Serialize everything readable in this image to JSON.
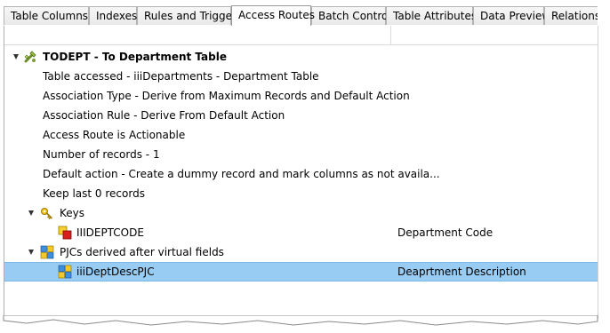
{
  "tabs": [
    {
      "label": "Table Columns"
    },
    {
      "label": "Indexes"
    },
    {
      "label": "Rules and Triggers"
    },
    {
      "label": "Access Routes",
      "active": true
    },
    {
      "label": "Batch Control"
    },
    {
      "label": "Table Attributes"
    },
    {
      "label": "Data Preview"
    },
    {
      "label": "Relationsh"
    }
  ],
  "tree": {
    "root_label": "TODEPT - To Department Table",
    "details": [
      "Table accessed - iiiDepartments - Department Table",
      "Association Type - Derive from Maximum Records and Default Action",
      "Association Rule - Derive From Default Action",
      "Access Route is Actionable",
      "Number of records - 1",
      "Default action - Create a dummy record and mark columns as not availa...",
      "Keep last 0 records"
    ],
    "keys": {
      "label": "Keys",
      "items": [
        {
          "name": "IIIDEPTCODE",
          "description": "Department Code"
        }
      ]
    },
    "pjcs": {
      "label": "PJCs derived after virtual fields",
      "items": [
        {
          "name": "iiiDeptDescPJC",
          "description": "Deaprtment Description"
        }
      ]
    }
  },
  "colors": {
    "selection": "#99ccf3",
    "tab_border": "#b3b3b3"
  }
}
